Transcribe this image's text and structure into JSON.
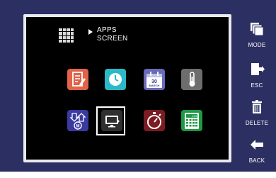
{
  "header": {
    "title_line1": "APPS",
    "title_line2": "SCREEN"
  },
  "apps": [
    {
      "name": "Report",
      "color": "#e0634a"
    },
    {
      "name": "Clock",
      "color": "#2bb9c7"
    },
    {
      "name": "Calendar",
      "color": "#6a6ab8",
      "day": "30",
      "month": "MARCH"
    },
    {
      "name": "Temperature",
      "color": "#6d6d6d"
    },
    {
      "name": "Motor",
      "color": "#3a3aa0"
    },
    {
      "name": "Display",
      "color": "#2f2f2f"
    },
    {
      "name": "Stopwatch",
      "color": "#7a1c22"
    },
    {
      "name": "Calculator",
      "color": "#1e9a44",
      "display": "123"
    }
  ],
  "sidebar": {
    "mode_label": "MODE",
    "esc_label": "ESC",
    "delete_label": "DELETE",
    "back_label": "BACK"
  },
  "colors": {
    "panel": "#2c2f62",
    "screen": "#000000",
    "bezel": "#e9e9ee"
  }
}
